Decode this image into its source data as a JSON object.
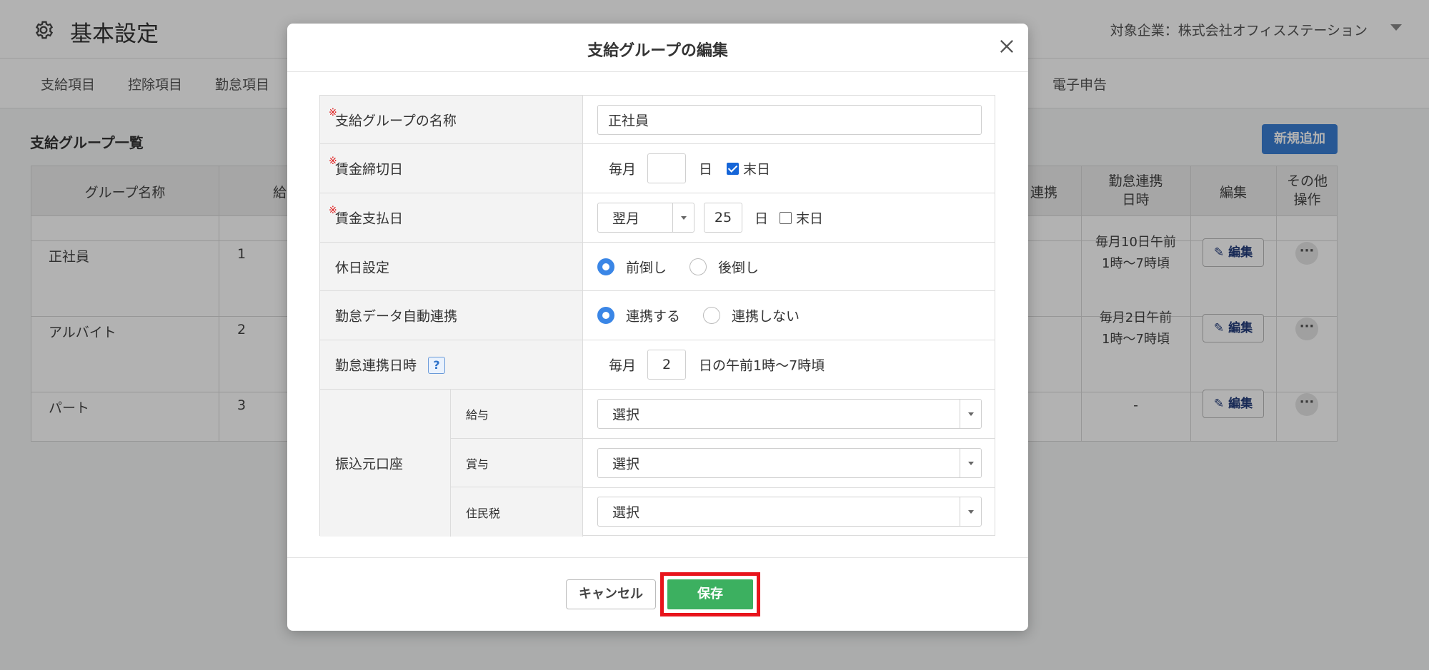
{
  "app": {
    "title": "基本設定",
    "company": "対象企業：株式会社オフィスステーション"
  },
  "tabs": [
    "支給項目",
    "控除項目",
    "勤怠項目",
    "電子申告"
  ],
  "list": {
    "title": "支給グループ一覧",
    "new_button": "新規追加",
    "headers": {
      "group_name": "グループ名称",
      "kyu": "給",
      "renkei": "連携",
      "renkei_time": "勤怠連携\n日時",
      "edit": "編集",
      "other": "その他\n操作"
    },
    "rows": [
      {
        "name": "正社員",
        "num": "1",
        "time": "毎月10日午前\n1時〜7時頃",
        "edit": "編集"
      },
      {
        "name": "アルバイト",
        "num": "2",
        "time": "毎月2日午前\n1時〜7時頃",
        "edit": "編集"
      },
      {
        "name": "パート",
        "num": "3",
        "time": "-",
        "edit": "編集"
      }
    ]
  },
  "modal": {
    "title": "支給グループの編集",
    "required_mark": "※",
    "fields": {
      "name_label": "支給グループの名称",
      "name_value": "正社員",
      "closing_label": "賃金締切日",
      "closing_prefix": "毎月",
      "closing_day": "",
      "closing_day_unit": "日",
      "closing_last_day": "末日",
      "closing_last_day_checked": true,
      "payday_label": "賃金支払日",
      "payday_month": "翌月",
      "payday_day": "25",
      "payday_day_unit": "日",
      "payday_last_day": "末日",
      "payday_last_day_checked": false,
      "holiday_label": "休日設定",
      "holiday_option_1": "前倒し",
      "holiday_option_2": "後倒し",
      "holiday_selected": "前倒し",
      "attendance_label": "勤怠データ自動連携",
      "attendance_option_1": "連携する",
      "attendance_option_2": "連携しない",
      "attendance_selected": "連携する",
      "sync_label": "勤怠連携日時",
      "sync_help": "?",
      "sync_prefix": "毎月",
      "sync_day": "2",
      "sync_suffix": "日の午前1時〜7時頃",
      "bank_label": "振込元口座",
      "bank_salary_label": "給与",
      "bank_salary_value": "選択",
      "bank_bonus_label": "賞与",
      "bank_bonus_value": "選択",
      "bank_tax_label": "住民税",
      "bank_tax_value": "選択"
    },
    "cancel_button": "キャンセル",
    "save_button": "保存"
  },
  "colors": {
    "primary": "#3a7fd5",
    "save": "#3cb060",
    "highlight": "#e8141c",
    "required": "#e02020"
  }
}
